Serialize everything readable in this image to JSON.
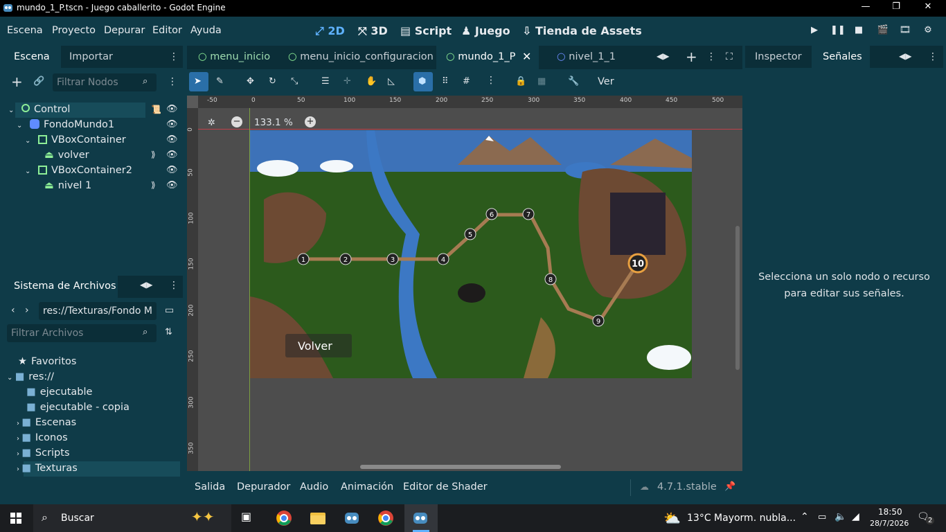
{
  "window": {
    "title": "mundo_1_P.tscn - Juego caballerito - Godot Engine"
  },
  "menu": [
    "Escena",
    "Proyecto",
    "Depurar",
    "Editor",
    "Ayuda"
  ],
  "workspaces": {
    "w2d": "2D",
    "w3d": "3D",
    "script": "Script",
    "game": "Juego",
    "assets": "Tienda de Assets"
  },
  "scene_panel": {
    "tab_scene": "Escena",
    "tab_import": "Importar",
    "filter_placeholder": "Filtrar Nodos",
    "nodes": [
      {
        "label": "Control",
        "icon": "control-node-icon",
        "color": "#8eef97"
      },
      {
        "label": "FondoMundo1",
        "icon": "texture-rect-icon",
        "color": "#5f8cff"
      },
      {
        "label": "VBoxContainer",
        "icon": "vbox-container-icon",
        "color": "#8eef97"
      },
      {
        "label": "volver",
        "icon": "texture-button-icon",
        "color": "#8eef97"
      },
      {
        "label": "VBoxContainer2",
        "icon": "vbox-container-icon",
        "color": "#8eef97"
      },
      {
        "label": "nivel 1",
        "icon": "texture-button-icon",
        "color": "#8eef97"
      }
    ]
  },
  "filesystem": {
    "title": "Sistema de Archivos",
    "path": "res://Texturas/Fondo M",
    "filter_placeholder": "Filtrar Archivos",
    "items": [
      {
        "label": "Favoritos",
        "icon": "star-icon"
      },
      {
        "label": "res://",
        "icon": "folder-icon"
      },
      {
        "label": "ejecutable",
        "icon": "folder-icon"
      },
      {
        "label": "ejecutable - copia",
        "icon": "folder-icon"
      },
      {
        "label": "Escenas",
        "icon": "folder-icon"
      },
      {
        "label": "Iconos",
        "icon": "folder-icon"
      },
      {
        "label": "Scripts",
        "icon": "folder-icon"
      },
      {
        "label": "Texturas",
        "icon": "folder-icon"
      }
    ]
  },
  "scene_tabs": [
    "menu_inicio",
    "menu_inicio_configuracion",
    "mundo_1_P",
    "nivel_1_1"
  ],
  "toolbar": {
    "view": "Ver"
  },
  "viewport": {
    "zoom": "133.1 %",
    "ruler_h": [
      "-50",
      "0",
      "50",
      "100",
      "150",
      "200",
      "250",
      "300",
      "350",
      "400",
      "450",
      "500"
    ],
    "ruler_v": [
      "0",
      "50",
      "100",
      "150",
      "200",
      "250",
      "300",
      "350"
    ],
    "button_volver": "Volver",
    "levels": [
      "1",
      "2",
      "3",
      "4",
      "5",
      "6",
      "7",
      "8",
      "9",
      "10"
    ]
  },
  "bottom": {
    "tabs": [
      "Salida",
      "Depurador",
      "Audio",
      "Animación",
      "Editor de Shader"
    ],
    "version": "4.7.1.stable"
  },
  "inspector": {
    "tab_inspector": "Inspector",
    "tab_signals": "Señales",
    "message": "Selecciona un solo nodo o recurso para editar sus señales."
  },
  "taskbar": {
    "search": "Buscar",
    "weather": "13°C  Mayorm. nubla...",
    "time": "18:50",
    "date": "28/7/2026",
    "notifications": "2"
  }
}
